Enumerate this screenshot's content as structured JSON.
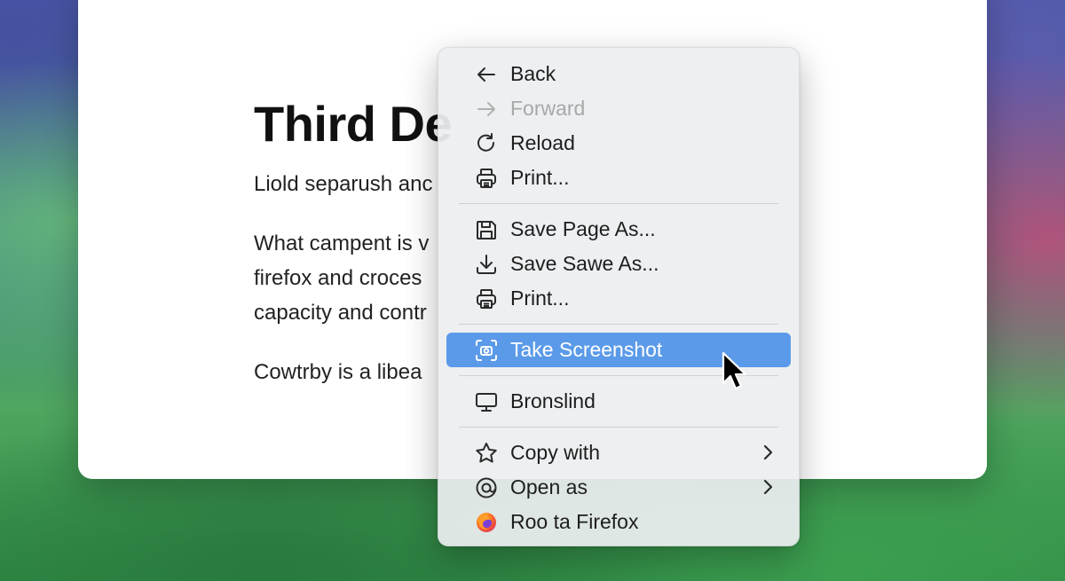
{
  "document": {
    "title": "Third De",
    "paragraphs": [
      [
        "Liold separush anc"
      ],
      [
        "What campent is v",
        "firefox and croces",
        "capacity and contr"
      ],
      [
        "Cowtrby is a libea"
      ]
    ]
  },
  "context_menu": {
    "items": [
      {
        "label": "Back",
        "icon": "arrow-left-icon",
        "enabled": true
      },
      {
        "label": "Forward",
        "icon": "arrow-right-icon",
        "enabled": false
      },
      {
        "label": "Reload",
        "icon": "reload-icon",
        "enabled": true
      },
      {
        "label": "Print...",
        "icon": "printer-icon",
        "enabled": true
      },
      {
        "label": "Save Page As...",
        "icon": "floppy-disk-icon",
        "enabled": true
      },
      {
        "label": "Save Sawe As...",
        "icon": "download-icon",
        "enabled": true
      },
      {
        "label": "Print...",
        "icon": "printer-icon",
        "enabled": true
      },
      {
        "label": "Take Screenshot",
        "icon": "camera-screenshot-icon",
        "enabled": true,
        "highlighted": true
      },
      {
        "label": "Bronslind",
        "icon": "monitor-icon",
        "enabled": true
      },
      {
        "label": "Copy with",
        "icon": "star-icon",
        "enabled": true,
        "submenu": true
      },
      {
        "label": "Open as",
        "icon": "circle-at-icon",
        "enabled": true,
        "submenu": true
      },
      {
        "label": "Roo ta Firefox",
        "icon": "firefox-icon",
        "enabled": true
      }
    ]
  },
  "colors": {
    "highlight": "#5b9ae8",
    "menu_background": "#eceef0",
    "disabled_text": "#a8a8a8"
  }
}
